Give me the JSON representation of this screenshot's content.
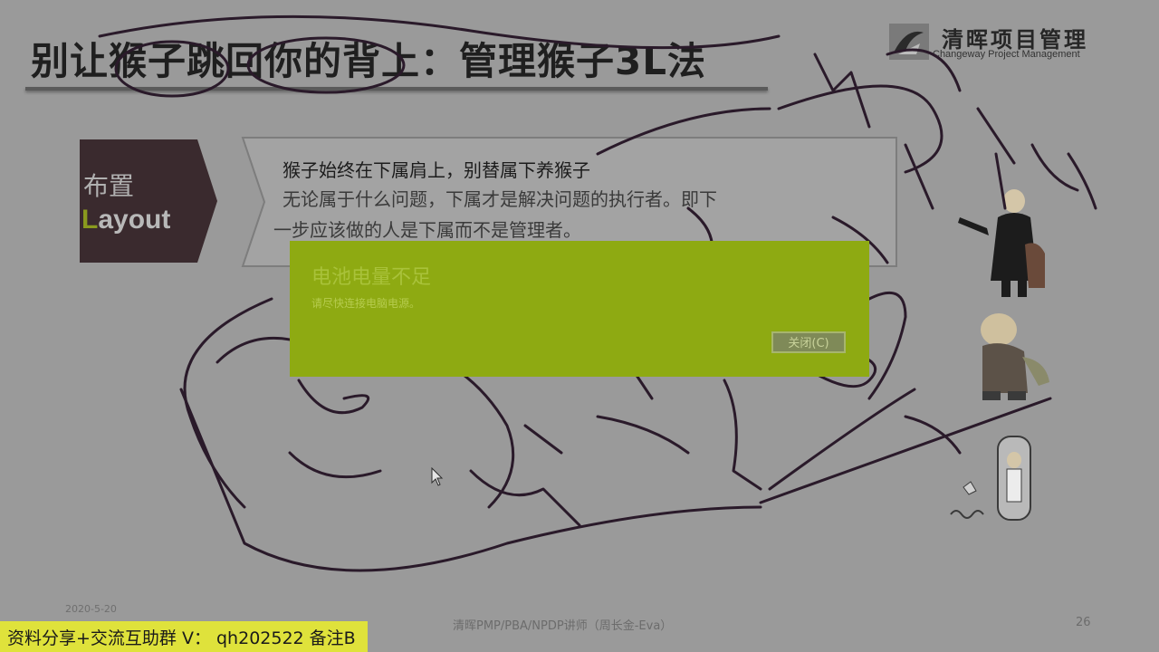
{
  "slide": {
    "title": "别让猴子跳回你的背上：管理猴子3L法",
    "logo_name": "清晖项目管理",
    "logo_sub": "Changeway Project Management",
    "layout_label_cn": "布置",
    "layout_label_en_first": "L",
    "layout_label_en_rest": "ayout",
    "content_line1": "猴子始终在下属肩上，别替属下养猴子",
    "content_line2": "无论属于什么问题，下属才是解决问题的执行者。即下",
    "content_line3": "一步应该做的人是下属而不是管理者。",
    "footer_date": "2020-5-20",
    "footer_center": "清晖PMP/PBA/NPDP讲师（周长金-Eva）",
    "page_number": "26"
  },
  "toast": {
    "title": "电池电量不足",
    "message": "请尽快连接电脑电源。",
    "close_label": "关闭(C)"
  },
  "overlay": {
    "share_text": "资料分享+交流互助群 V： qh202522 备注B"
  },
  "colors": {
    "toast_bg": "#8eaa12",
    "share_bar_bg": "#dfe23b",
    "layout_tag_bg": "#3a2a2e",
    "ink": "#2a1a2a"
  }
}
